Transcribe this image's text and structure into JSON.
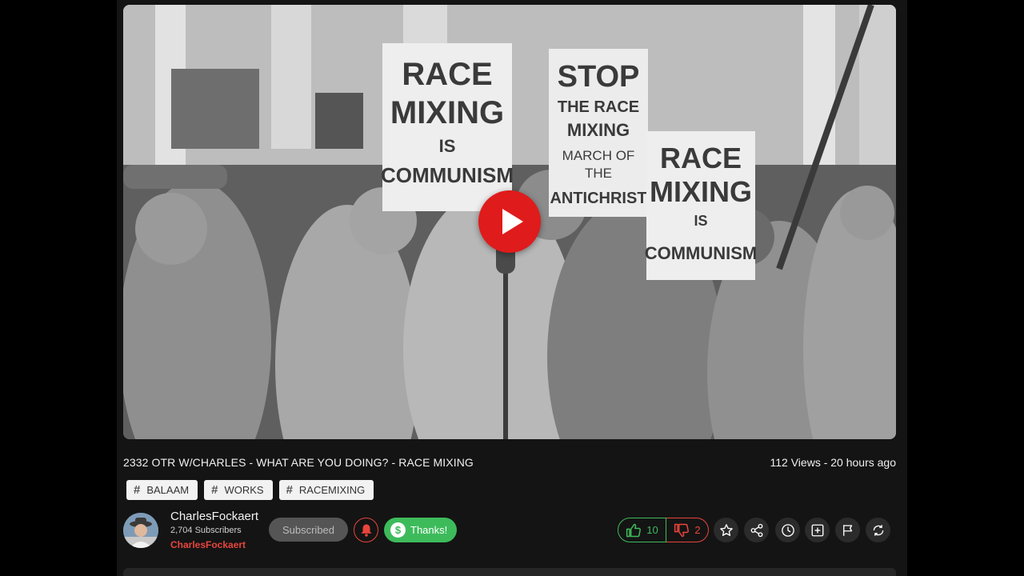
{
  "video": {
    "title": "2332 OTR W/CHARLES - WHAT ARE YOU DOING? - RACE MIXING",
    "views_age": "112 Views - 20 hours ago",
    "thumbnail_signs": [
      {
        "lines": [
          "RACE",
          "MIXING",
          "IS",
          "COMMUNISM"
        ]
      },
      {
        "lines": [
          "STOP",
          "THE RACE",
          "MIXING",
          "MARCH OF",
          "THE",
          "ANTICHRIST"
        ]
      },
      {
        "lines": [
          "RACE",
          "MIXING",
          "IS",
          "COMMUNISM"
        ]
      }
    ]
  },
  "tags": [
    {
      "label": "BALAAM"
    },
    {
      "label": "WORKS"
    },
    {
      "label": "RACEMIXING"
    }
  ],
  "channel": {
    "name": "CharlesFockaert",
    "subscribers": "2,704 Subscribers",
    "link_label": "CharlesFockaert",
    "subscribe_label": "Subscribed",
    "thanks_label": "Thanks!",
    "thanks_symbol": "$"
  },
  "votes": {
    "up": "10",
    "down": "2"
  },
  "icons": [
    "play-icon",
    "hashtag-icon",
    "bell-icon",
    "dollar-icon",
    "thumbs-up-icon",
    "thumbs-down-icon",
    "star-icon",
    "share-icon",
    "clock-icon",
    "add-playlist-icon",
    "flag-icon",
    "loop-icon"
  ],
  "colors": {
    "background": "#141414",
    "play": "#e01b1b",
    "accent_green": "#3dbb5b",
    "accent_red": "#e8453c"
  }
}
